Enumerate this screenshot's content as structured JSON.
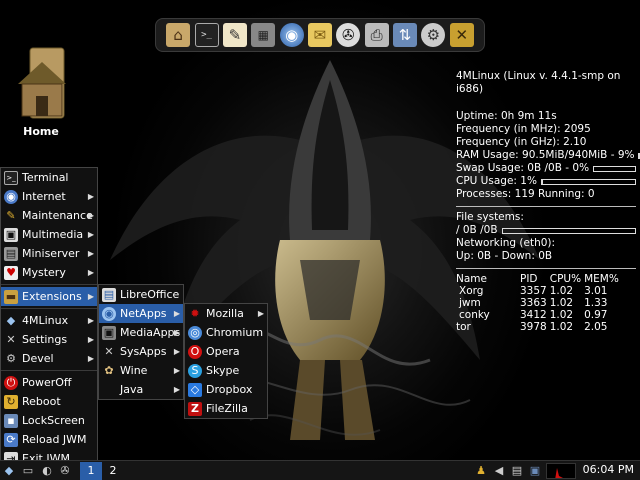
{
  "desktop": {
    "home_label": "Home"
  },
  "dock": {
    "icons": [
      "home-folder-icon",
      "terminal-icon",
      "text-editor-icon",
      "calculator-icon",
      "web-browser-icon",
      "mail-icon",
      "media-player-icon",
      "printer-icon",
      "network-icon",
      "settings-icon",
      "tools-icon"
    ]
  },
  "conky": {
    "title": "4MLinux (Linux v. 4.4.1-smp on i686)",
    "uptime": "Uptime: 0h 9m 11s",
    "freq_mhz": "Frequency (in MHz): 2095",
    "freq_ghz": "Frequency (in GHz): 2.10",
    "ram": "RAM Usage: 90.5MiB/940MiB - 9%",
    "ram_fraction": 0.09,
    "swap": "Swap Usage: 0B /0B - 0%",
    "swap_fraction": 0,
    "cpu": "CPU Usage: 1%",
    "cpu_fraction": 0.01,
    "processes": "Processes: 119 Running: 0",
    "fs_label": "File systems:",
    "fs_value": "/ 0B /0B",
    "fs_fraction": 0,
    "net_label": "Networking (eth0):",
    "net_value": "Up: 0B - Down: 0B",
    "proc_headers": [
      "Name",
      "PID",
      "CPU%",
      "MEM%"
    ],
    "procs": [
      [
        "Xorg",
        "3357",
        "1.02",
        "3.01"
      ],
      [
        "jwm",
        "3363",
        "1.02",
        "1.33"
      ],
      [
        "conky",
        "3412",
        "1.02",
        "0.97"
      ],
      [
        "tor",
        "3978",
        "1.02",
        "2.05"
      ]
    ]
  },
  "main_menu": {
    "items": [
      {
        "label": "Terminal"
      },
      {
        "label": "Internet"
      },
      {
        "label": "Maintenance"
      },
      {
        "label": "Multimedia"
      },
      {
        "label": "Miniserver"
      },
      {
        "label": "Mystery"
      },
      {
        "label": "Extensions"
      },
      {
        "label": "4MLinux"
      },
      {
        "label": "Settings"
      },
      {
        "label": "Devel"
      },
      {
        "label": "PowerOff"
      },
      {
        "label": "Reboot"
      },
      {
        "label": "LockScreen"
      },
      {
        "label": "Reload JWM"
      },
      {
        "label": "Exit JWM"
      }
    ]
  },
  "extensions_menu": {
    "items": [
      {
        "label": "LibreOffice"
      },
      {
        "label": "NetApps"
      },
      {
        "label": "MediaApps"
      },
      {
        "label": "SysApps"
      },
      {
        "label": "Wine"
      },
      {
        "label": "Java"
      }
    ]
  },
  "netapps_menu": {
    "items": [
      {
        "label": "Mozilla"
      },
      {
        "label": "Chromium"
      },
      {
        "label": "Opera"
      },
      {
        "label": "Skype"
      },
      {
        "label": "Dropbox"
      },
      {
        "label": "FileZilla"
      }
    ]
  },
  "taskbar": {
    "workspace_1": "1",
    "workspace_2": "2",
    "clock": "06:04 PM"
  },
  "colors": {
    "menu_highlight": "#2a5ea8",
    "accent_red": "#d01010"
  }
}
